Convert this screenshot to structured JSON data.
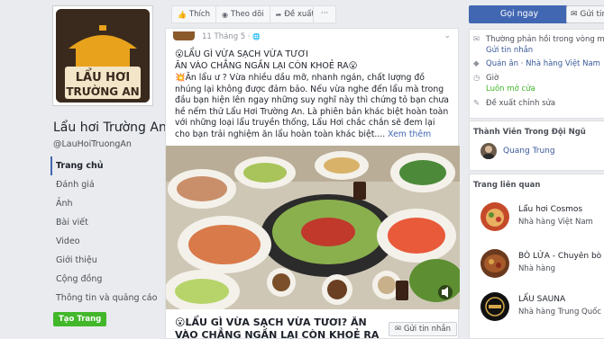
{
  "page": {
    "name": "Lẩu hơi Trường An",
    "handle": "@LauHoiTruongAn",
    "logo_text_line1": "LẨU HƠI",
    "logo_text_line2": "TRƯỜNG AN"
  },
  "nav": {
    "items": [
      {
        "label": "Trang chủ"
      },
      {
        "label": "Đánh giá"
      },
      {
        "label": "Ảnh"
      },
      {
        "label": "Bài viết"
      },
      {
        "label": "Video"
      },
      {
        "label": "Giới thiệu"
      },
      {
        "label": "Cộng đồng"
      },
      {
        "label": "Thông tin và quảng cáo"
      }
    ],
    "create_page": "Tạo Trang"
  },
  "actions": {
    "like": "Thích",
    "follow": "Theo dõi",
    "suggest": "Đề xuất",
    "more": "···"
  },
  "post": {
    "date": "11 Tháng 5 ·",
    "headline_line1": "😮LẨU GÌ VỪA SẠCH VỪA TƯƠI",
    "headline_line2": "ĂN VÀO CHẲNG NGẦN LẠI CÒN KHOẺ RA😮",
    "body": "💥Ăn lẩu ư ? Vừa nhiều dầu mỡ, nhanh ngán, chất lượng đồ nhúng lại không được đảm bảo. Nếu vừa nghe đến lẩu mà trong đầu bạn hiện lên ngay những suy nghĩ này thì chứng tỏ bạn chưa hề nếm thử Lẩu Hơi Trường An. Là phiên bản khác biệt hoàn toàn với những loại lẩu truyền thống, Lẩu Hơi chắc chắn sẽ đem lại cho bạn trải nghiệm ăn lẩu hoàn toàn khác biệt.... ",
    "see_more": "Xem thêm",
    "link_title": "😮LẨU GÌ VỪA SẠCH VỪA TƯƠI? ĂN VÀO CHẲNG NGẦN LẠI CÒN KHOẺ RA😮",
    "message_button": "Gửi tin nhắn"
  },
  "sidebar": {
    "call_button": "Gọi ngay",
    "send_button": "Gửi tin",
    "response_text": "Thường phản hồi trong vòng một giờ",
    "send_message": "Gửi tin nhắn",
    "category_1": "Quán ăn",
    "category_sep": " · ",
    "category_2": "Nhà hàng Việt Nam",
    "hours_label": "Giờ",
    "hours_value": "Luôn mở cửa",
    "suggest_edit": "Đề xuất chỉnh sửa",
    "team_title": "Thành Viên Trong Đội Ngũ",
    "team_member": "Quang Trung",
    "related_title": "Trang liên quan",
    "related": [
      {
        "name": "Lẩu hơi Cosmos",
        "category": "Nhà hàng Việt Nam"
      },
      {
        "name": "BÒ LỬA - Chuyên bò ...",
        "category": "Nhà hàng"
      },
      {
        "name": "LẨU SAUNA",
        "category": "Nhà hàng Trung Quốc"
      }
    ]
  },
  "colors": {
    "accent": "#4267b2",
    "background": "#e9ebee",
    "create_btn": "#42b72a"
  }
}
